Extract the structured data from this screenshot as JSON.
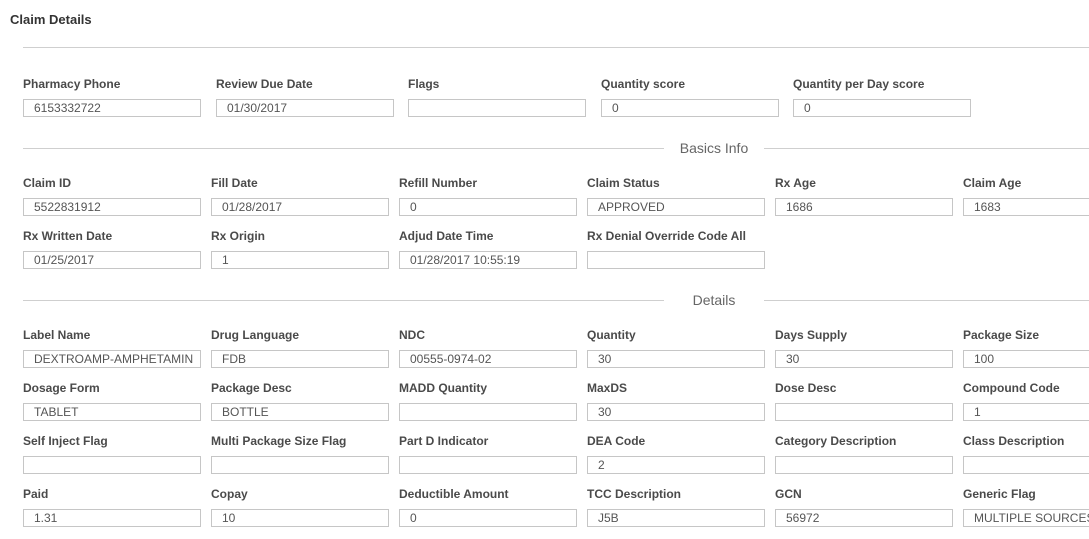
{
  "page": {
    "title": "Claim Details"
  },
  "sections": {
    "basics": "Basics Info",
    "details": "Details"
  },
  "top": {
    "pharmacy_phone": {
      "label": "Pharmacy Phone",
      "value": "6153332722"
    },
    "review_due_date": {
      "label": "Review Due Date",
      "value": "01/30/2017"
    },
    "flags": {
      "label": "Flags",
      "value": ""
    },
    "quantity_score": {
      "label": "Quantity score",
      "value": "0"
    },
    "quantity_per_day_score": {
      "label": "Quantity per Day score",
      "value": "0"
    }
  },
  "basics": {
    "claim_id": {
      "label": "Claim ID",
      "value": "5522831912"
    },
    "fill_date": {
      "label": "Fill Date",
      "value": "01/28/2017"
    },
    "refill_number": {
      "label": "Refill Number",
      "value": "0"
    },
    "claim_status": {
      "label": "Claim Status",
      "value": "APPROVED"
    },
    "rx_age": {
      "label": "Rx Age",
      "value": "1686"
    },
    "claim_age": {
      "label": "Claim Age",
      "value": "1683"
    },
    "rx_written_date": {
      "label": "Rx Written Date",
      "value": "01/25/2017"
    },
    "rx_origin": {
      "label": "Rx Origin",
      "value": "1"
    },
    "adjud_date_time": {
      "label": "Adjud Date Time",
      "value": "01/28/2017 10:55:19"
    },
    "rx_denial_override": {
      "label": "Rx Denial Override Code All",
      "value": ""
    }
  },
  "details": {
    "label_name": {
      "label": "Label Name",
      "value": "DEXTROAMP-AMPHETAMIN"
    },
    "drug_language": {
      "label": "Drug Language",
      "value": "FDB"
    },
    "ndc": {
      "label": "NDC",
      "value": "00555-0974-02"
    },
    "quantity": {
      "label": "Quantity",
      "value": "30"
    },
    "days_supply": {
      "label": "Days Supply",
      "value": "30"
    },
    "package_size": {
      "label": "Package Size",
      "value": "100"
    },
    "dosage_form": {
      "label": "Dosage Form",
      "value": "TABLET"
    },
    "package_desc": {
      "label": "Package Desc",
      "value": "BOTTLE"
    },
    "madd_quantity": {
      "label": "MADD Quantity",
      "value": ""
    },
    "maxds": {
      "label": "MaxDS",
      "value": "30"
    },
    "dose_desc": {
      "label": "Dose Desc",
      "value": ""
    },
    "compound_code": {
      "label": "Compound Code",
      "value": "1"
    },
    "self_inject_flag": {
      "label": "Self Inject Flag",
      "value": ""
    },
    "multi_package_size_flag": {
      "label": "Multi Package Size Flag",
      "value": ""
    },
    "part_d_indicator": {
      "label": "Part D Indicator",
      "value": ""
    },
    "dea_code": {
      "label": "DEA Code",
      "value": "2"
    },
    "category_description": {
      "label": "Category Description",
      "value": ""
    },
    "class_description": {
      "label": "Class Description",
      "value": ""
    },
    "paid": {
      "label": "Paid",
      "value": "1.31"
    },
    "copay": {
      "label": "Copay",
      "value": "10"
    },
    "deductible_amount": {
      "label": "Deductible Amount",
      "value": "0"
    },
    "tcc_description": {
      "label": "TCC Description",
      "value": "J5B"
    },
    "gcn": {
      "label": "GCN",
      "value": "56972"
    },
    "generic_flag": {
      "label": "Generic Flag",
      "value": "MULTIPLE SOURCES"
    }
  }
}
